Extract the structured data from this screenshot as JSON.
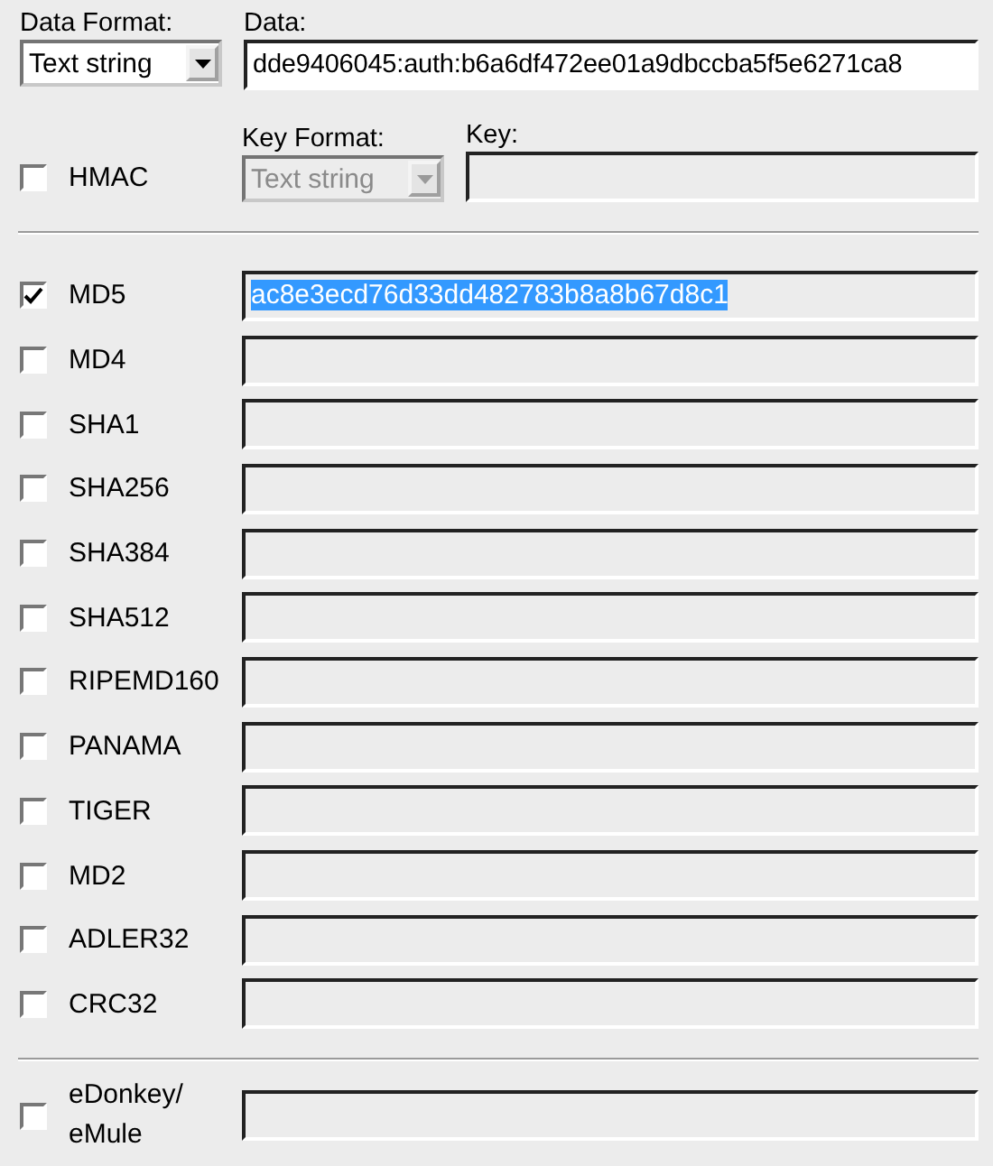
{
  "data_format": {
    "label": "Data Format:",
    "value": "Text string"
  },
  "data": {
    "label": "Data:",
    "value": "dde9406045:auth:b6a6df472ee01a9dbccba5f5e6271ca8"
  },
  "hmac": {
    "label": "HMAC",
    "checked": false
  },
  "key_format": {
    "label": "Key Format:",
    "value": "Text string",
    "disabled": true
  },
  "key": {
    "label": "Key:",
    "disabled": true
  },
  "hashes": [
    {
      "name": "MD5",
      "checked": true,
      "value": "ac8e3ecd76d33dd482783b8a8b67d8c1",
      "highlighted": true
    },
    {
      "name": "MD4",
      "checked": false
    },
    {
      "name": "SHA1",
      "checked": false
    },
    {
      "name": "SHA256",
      "checked": false
    },
    {
      "name": "SHA384",
      "checked": false
    },
    {
      "name": "SHA512",
      "checked": false
    },
    {
      "name": "RIPEMD160",
      "checked": false
    },
    {
      "name": "PANAMA",
      "checked": false
    },
    {
      "name": "TIGER",
      "checked": false
    },
    {
      "name": "MD2",
      "checked": false
    },
    {
      "name": "ADLER32",
      "checked": false
    },
    {
      "name": "CRC32",
      "checked": false
    }
  ],
  "extra_hashes": [
    {
      "name": "eDonkey/ eMule",
      "checked": false
    }
  ]
}
